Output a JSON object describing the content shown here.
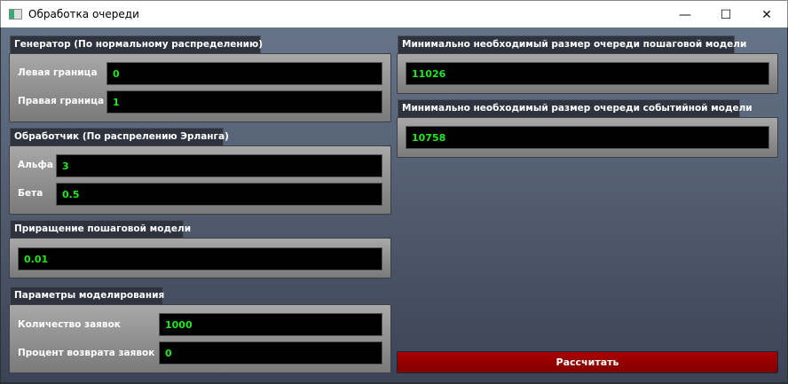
{
  "window": {
    "title": "Обработка очереди",
    "minimize": "—",
    "maximize": "☐",
    "close": "✕"
  },
  "generator": {
    "title": "Генератор (По нормальному распределению)",
    "left_label": "Левая граница",
    "left_value": "0",
    "right_label": "Правая граница",
    "right_value": "1"
  },
  "processor": {
    "title": "Обработчик (По распрелению Эрланга)",
    "alpha_label": "Альфа",
    "alpha_value": "3",
    "beta_label": "Бета",
    "beta_value": "0.5"
  },
  "step": {
    "title": "Приращение пошаговой модели",
    "value": "0.01"
  },
  "params": {
    "title": "Параметры моделирования",
    "count_label": "Количество заявок",
    "count_value": "1000",
    "return_label": "Процент возврата заявок",
    "return_value": "0"
  },
  "results": {
    "step_title": "Минимально необходимый размер очереди  пошаговой модели",
    "step_value": "11026",
    "event_title": "Минимально необходимый размер очереди  событийной модели",
    "event_value": "10758"
  },
  "actions": {
    "calculate": "Рассчитать"
  },
  "colors": {
    "value_text": "#1ee81e",
    "button": "#a00000"
  }
}
